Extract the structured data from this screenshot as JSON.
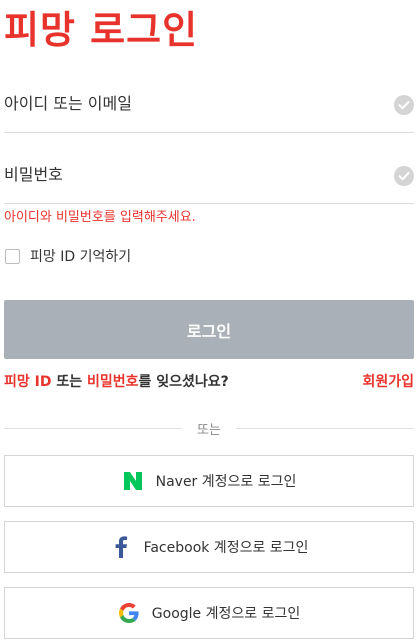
{
  "page": {
    "title": "피망 로그인"
  },
  "form": {
    "id_placeholder": "아이디 또는 이메일",
    "pw_placeholder": "비밀번호",
    "error": "아이디와 비밀번호를 입력해주세요.",
    "remember_label": "피망 ID 기억하기",
    "login_label": "로그인"
  },
  "help": {
    "pimang_id": "피망 ID",
    "or_word": " 또는 ",
    "password": "비밀번호",
    "suffix": "를 잊으셨나요?",
    "signup": "회원가입"
  },
  "divider": {
    "label": "또는"
  },
  "social": {
    "naver_label": "Naver 계정으로 로그인",
    "facebook_label": "Facebook 계정으로 로그인",
    "google_label": "Google 계정으로 로그인"
  },
  "colors": {
    "brand_red": "#e8332c",
    "login_button_disabled": "#a9b0b7",
    "naver_green": "#03c75a",
    "facebook_blue": "#3b5998"
  },
  "icons": {
    "field_status": "check-circle-icon",
    "naver": "naver-logo-icon",
    "facebook": "facebook-logo-icon",
    "google": "google-logo-icon"
  }
}
